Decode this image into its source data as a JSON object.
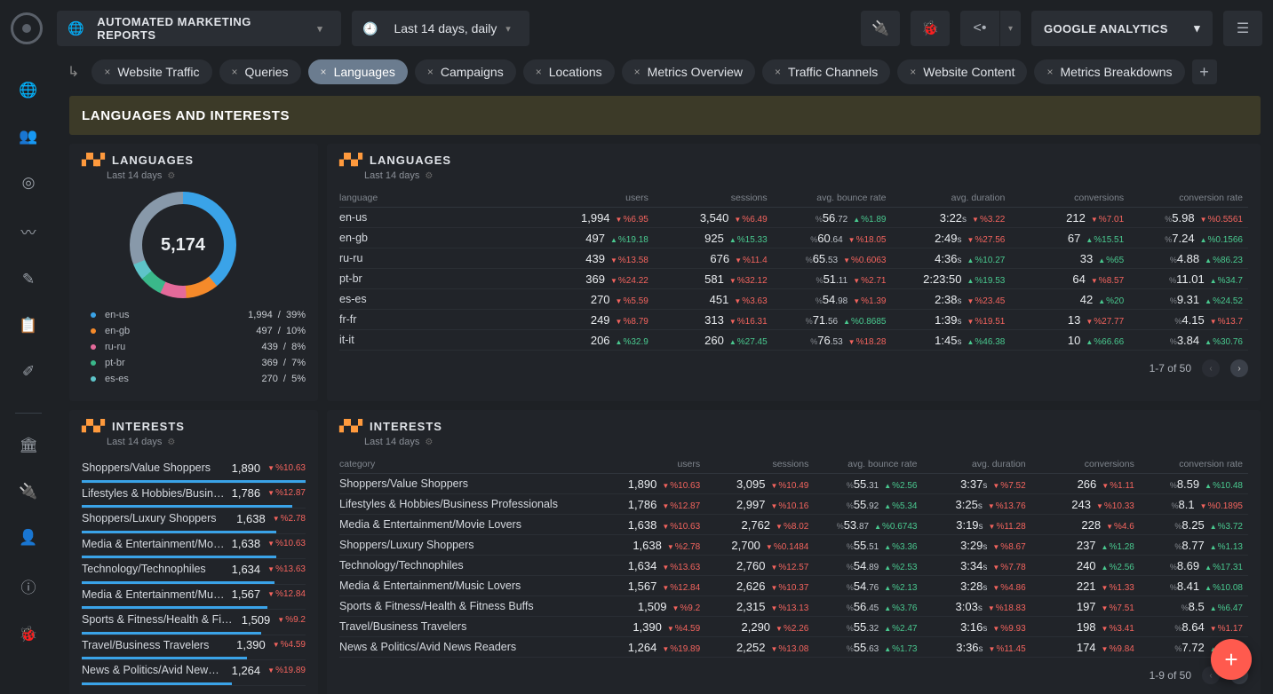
{
  "header": {
    "workspace": "AUTOMATED MARKETING REPORTS",
    "daterange": "Last 14 days, daily",
    "integration": "GOOGLE ANALYTICS"
  },
  "tabs": [
    "Website Traffic",
    "Queries",
    "Languages",
    "Campaigns",
    "Locations",
    "Metrics Overview",
    "Traffic Channels",
    "Website Content",
    "Metrics Breakdowns"
  ],
  "activeTab": 2,
  "pageTitle": "LANGUAGES AND INTERESTS",
  "langSummary": {
    "title": "LANGUAGES",
    "sub": "Last 14 days",
    "total": "5,174",
    "legend": [
      {
        "color": "#3aa3e8",
        "label": "en-us",
        "val": "1,994",
        "pct": "39%"
      },
      {
        "color": "#f58a2a",
        "label": "en-gb",
        "val": "497",
        "pct": "10%"
      },
      {
        "color": "#e46a9a",
        "label": "ru-ru",
        "val": "439",
        "pct": "8%"
      },
      {
        "color": "#3ab88a",
        "label": "pt-br",
        "val": "369",
        "pct": "7%"
      },
      {
        "color": "#5ec4c9",
        "label": "es-es",
        "val": "270",
        "pct": "5%"
      }
    ]
  },
  "langTable": {
    "title": "LANGUAGES",
    "sub": "Last 14 days",
    "cols": [
      "language",
      "users",
      "sessions",
      "avg. bounce rate",
      "avg. duration",
      "conversions",
      "conversion rate"
    ],
    "pager": "1-7 of 50",
    "rows": [
      {
        "k": "en-us",
        "u": {
          "v": "1,994",
          "d": "%6.95",
          "dir": "down"
        },
        "s": {
          "v": "3,540",
          "d": "%6.49",
          "dir": "down"
        },
        "b": {
          "v": "56",
          "sm": ".72",
          "d": "%1.89",
          "dir": "up"
        },
        "dur": {
          "v": "3:22",
          "sm": "s",
          "d": "%3.22",
          "dir": "down"
        },
        "c": {
          "v": "212",
          "d": "%7.01",
          "dir": "down"
        },
        "cr": {
          "v": "5.98",
          "d": "%0.5561",
          "dir": "down"
        }
      },
      {
        "k": "en-gb",
        "u": {
          "v": "497",
          "d": "%19.18",
          "dir": "up"
        },
        "s": {
          "v": "925",
          "d": "%15.33",
          "dir": "up"
        },
        "b": {
          "v": "60",
          "sm": ".64",
          "d": "%18.05",
          "dir": "down"
        },
        "dur": {
          "v": "2:49",
          "sm": "s",
          "d": "%27.56",
          "dir": "down"
        },
        "c": {
          "v": "67",
          "d": "%15.51",
          "dir": "up"
        },
        "cr": {
          "v": "7.24",
          "d": "%0.1566",
          "dir": "up"
        }
      },
      {
        "k": "ru-ru",
        "u": {
          "v": "439",
          "d": "%13.58",
          "dir": "down"
        },
        "s": {
          "v": "676",
          "d": "%11.4",
          "dir": "down"
        },
        "b": {
          "v": "65",
          "sm": ".53",
          "d": "%0.6063",
          "dir": "down"
        },
        "dur": {
          "v": "4:36",
          "sm": "s",
          "d": "%10.27",
          "dir": "up"
        },
        "c": {
          "v": "33",
          "d": "%65",
          "dir": "up"
        },
        "cr": {
          "v": "4.88",
          "d": "%86.23",
          "dir": "up"
        }
      },
      {
        "k": "pt-br",
        "u": {
          "v": "369",
          "d": "%24.22",
          "dir": "down"
        },
        "s": {
          "v": "581",
          "d": "%32.12",
          "dir": "down"
        },
        "b": {
          "v": "51",
          "sm": ".11",
          "d": "%2.71",
          "dir": "down"
        },
        "dur": {
          "v": "2:23:50",
          "sm": "",
          "d": "%19.53",
          "dir": "up"
        },
        "c": {
          "v": "64",
          "d": "%8.57",
          "dir": "down"
        },
        "cr": {
          "v": "11.01",
          "d": "%34.7",
          "dir": "up"
        }
      },
      {
        "k": "es-es",
        "u": {
          "v": "270",
          "d": "%5.59",
          "dir": "down"
        },
        "s": {
          "v": "451",
          "d": "%3.63",
          "dir": "down"
        },
        "b": {
          "v": "54",
          "sm": ".98",
          "d": "%1.39",
          "dir": "down"
        },
        "dur": {
          "v": "2:38",
          "sm": "s",
          "d": "%23.45",
          "dir": "down"
        },
        "c": {
          "v": "42",
          "d": "%20",
          "dir": "up"
        },
        "cr": {
          "v": "9.31",
          "d": "%24.52",
          "dir": "up"
        }
      },
      {
        "k": "fr-fr",
        "u": {
          "v": "249",
          "d": "%8.79",
          "dir": "down"
        },
        "s": {
          "v": "313",
          "d": "%16.31",
          "dir": "down"
        },
        "b": {
          "v": "71",
          "sm": ".56",
          "d": "%0.8685",
          "dir": "up"
        },
        "dur": {
          "v": "1:39",
          "sm": "s",
          "d": "%19.51",
          "dir": "down"
        },
        "c": {
          "v": "13",
          "d": "%27.77",
          "dir": "down"
        },
        "cr": {
          "v": "4.15",
          "d": "%13.7",
          "dir": "down"
        }
      },
      {
        "k": "it-it",
        "u": {
          "v": "206",
          "d": "%32.9",
          "dir": "up"
        },
        "s": {
          "v": "260",
          "d": "%27.45",
          "dir": "up"
        },
        "b": {
          "v": "76",
          "sm": ".53",
          "d": "%18.28",
          "dir": "down"
        },
        "dur": {
          "v": "1:45",
          "sm": "s",
          "d": "%46.38",
          "dir": "up"
        },
        "c": {
          "v": "10",
          "d": "%66.66",
          "dir": "up"
        },
        "cr": {
          "v": "3.84",
          "d": "%30.76",
          "dir": "up"
        }
      }
    ]
  },
  "intBars": {
    "title": "INTERESTS",
    "sub": "Last 14 days",
    "max": 1890,
    "rows": [
      {
        "label": "Shoppers/Value Shoppers",
        "v": "1,890",
        "n": 1890,
        "d": "%10.63",
        "dir": "down"
      },
      {
        "label": "Lifestyles & Hobbies/Busin…",
        "v": "1,786",
        "n": 1786,
        "d": "%12.87",
        "dir": "down"
      },
      {
        "label": "Shoppers/Luxury Shoppers",
        "v": "1,638",
        "n": 1638,
        "d": "%2.78",
        "dir": "down"
      },
      {
        "label": "Media & Entertainment/Mo…",
        "v": "1,638",
        "n": 1638,
        "d": "%10.63",
        "dir": "down"
      },
      {
        "label": "Technology/Technophiles",
        "v": "1,634",
        "n": 1634,
        "d": "%13.63",
        "dir": "down"
      },
      {
        "label": "Media & Entertainment/Mu…",
        "v": "1,567",
        "n": 1567,
        "d": "%12.84",
        "dir": "down"
      },
      {
        "label": "Sports & Fitness/Health & Fit…",
        "v": "1,509",
        "n": 1509,
        "d": "%9.2",
        "dir": "down"
      },
      {
        "label": "Travel/Business Travelers",
        "v": "1,390",
        "n": 1390,
        "d": "%4.59",
        "dir": "down"
      },
      {
        "label": "News & Politics/Avid News…",
        "v": "1,264",
        "n": 1264,
        "d": "%19.89",
        "dir": "down"
      }
    ]
  },
  "intTable": {
    "title": "INTERESTS",
    "sub": "Last 14 days",
    "cols": [
      "category",
      "users",
      "sessions",
      "avg. bounce rate",
      "avg. duration",
      "conversions",
      "conversion rate"
    ],
    "pager": "1-9 of 50",
    "rows": [
      {
        "k": "Shoppers/Value Shoppers",
        "u": {
          "v": "1,890",
          "d": "%10.63",
          "dir": "down"
        },
        "s": {
          "v": "3,095",
          "d": "%10.49",
          "dir": "down"
        },
        "b": {
          "v": "55",
          "sm": ".31",
          "d": "%2.56",
          "dir": "up"
        },
        "dur": {
          "v": "3:37",
          "sm": "s",
          "d": "%7.52",
          "dir": "down"
        },
        "c": {
          "v": "266",
          "d": "%1.11",
          "dir": "down"
        },
        "cr": {
          "v": "8.59",
          "d": "%10.48",
          "dir": "up"
        }
      },
      {
        "k": "Lifestyles & Hobbies/Business Professionals",
        "u": {
          "v": "1,786",
          "d": "%12.87",
          "dir": "down"
        },
        "s": {
          "v": "2,997",
          "d": "%10.16",
          "dir": "down"
        },
        "b": {
          "v": "55",
          "sm": ".92",
          "d": "%5.34",
          "dir": "up"
        },
        "dur": {
          "v": "3:25",
          "sm": "s",
          "d": "%13.76",
          "dir": "down"
        },
        "c": {
          "v": "243",
          "d": "%10.33",
          "dir": "down"
        },
        "cr": {
          "v": "8.1",
          "d": "%0.1895",
          "dir": "down"
        }
      },
      {
        "k": "Media & Entertainment/Movie Lovers",
        "u": {
          "v": "1,638",
          "d": "%10.63",
          "dir": "down"
        },
        "s": {
          "v": "2,762",
          "d": "%8.02",
          "dir": "down"
        },
        "b": {
          "v": "53",
          "sm": ".87",
          "d": "%0.6743",
          "dir": "up"
        },
        "dur": {
          "v": "3:19",
          "sm": "s",
          "d": "%11.28",
          "dir": "down"
        },
        "c": {
          "v": "228",
          "d": "%4.6",
          "dir": "down"
        },
        "cr": {
          "v": "8.25",
          "d": "%3.72",
          "dir": "up"
        }
      },
      {
        "k": "Shoppers/Luxury Shoppers",
        "u": {
          "v": "1,638",
          "d": "%2.78",
          "dir": "down"
        },
        "s": {
          "v": "2,700",
          "d": "%0.1484",
          "dir": "down"
        },
        "b": {
          "v": "55",
          "sm": ".51",
          "d": "%3.36",
          "dir": "up"
        },
        "dur": {
          "v": "3:29",
          "sm": "s",
          "d": "%8.67",
          "dir": "down"
        },
        "c": {
          "v": "237",
          "d": "%1.28",
          "dir": "up"
        },
        "cr": {
          "v": "8.77",
          "d": "%1.13",
          "dir": "up"
        }
      },
      {
        "k": "Technology/Technophiles",
        "u": {
          "v": "1,634",
          "d": "%13.63",
          "dir": "down"
        },
        "s": {
          "v": "2,760",
          "d": "%12.57",
          "dir": "down"
        },
        "b": {
          "v": "54",
          "sm": ".89",
          "d": "%2.53",
          "dir": "up"
        },
        "dur": {
          "v": "3:34",
          "sm": "s",
          "d": "%7.78",
          "dir": "down"
        },
        "c": {
          "v": "240",
          "d": "%2.56",
          "dir": "up"
        },
        "cr": {
          "v": "8.69",
          "d": "%17.31",
          "dir": "up"
        }
      },
      {
        "k": "Media & Entertainment/Music Lovers",
        "u": {
          "v": "1,567",
          "d": "%12.84",
          "dir": "down"
        },
        "s": {
          "v": "2,626",
          "d": "%10.37",
          "dir": "down"
        },
        "b": {
          "v": "54",
          "sm": ".76",
          "d": "%2.13",
          "dir": "up"
        },
        "dur": {
          "v": "3:28",
          "sm": "s",
          "d": "%4.86",
          "dir": "down"
        },
        "c": {
          "v": "221",
          "d": "%1.33",
          "dir": "down"
        },
        "cr": {
          "v": "8.41",
          "d": "%10.08",
          "dir": "up"
        }
      },
      {
        "k": "Sports & Fitness/Health & Fitness Buffs",
        "u": {
          "v": "1,509",
          "d": "%9.2",
          "dir": "down"
        },
        "s": {
          "v": "2,315",
          "d": "%13.13",
          "dir": "down"
        },
        "b": {
          "v": "56",
          "sm": ".45",
          "d": "%3.76",
          "dir": "up"
        },
        "dur": {
          "v": "3:03",
          "sm": "s",
          "d": "%18.83",
          "dir": "down"
        },
        "c": {
          "v": "197",
          "d": "%7.51",
          "dir": "down"
        },
        "cr": {
          "v": "8.5",
          "d": "%6.47",
          "dir": "up"
        }
      },
      {
        "k": "Travel/Business Travelers",
        "u": {
          "v": "1,390",
          "d": "%4.59",
          "dir": "down"
        },
        "s": {
          "v": "2,290",
          "d": "%2.26",
          "dir": "down"
        },
        "b": {
          "v": "55",
          "sm": ".32",
          "d": "%2.47",
          "dir": "up"
        },
        "dur": {
          "v": "3:16",
          "sm": "s",
          "d": "%9.93",
          "dir": "down"
        },
        "c": {
          "v": "198",
          "d": "%3.41",
          "dir": "down"
        },
        "cr": {
          "v": "8.64",
          "d": "%1.17",
          "dir": "down"
        }
      },
      {
        "k": "News & Politics/Avid News Readers",
        "u": {
          "v": "1,264",
          "d": "%19.89",
          "dir": "down"
        },
        "s": {
          "v": "2,252",
          "d": "%13.08",
          "dir": "down"
        },
        "b": {
          "v": "55",
          "sm": ".63",
          "d": "%1.73",
          "dir": "up"
        },
        "dur": {
          "v": "3:36",
          "sm": "s",
          "d": "%11.45",
          "dir": "down"
        },
        "c": {
          "v": "174",
          "d": "%9.84",
          "dir": "down"
        },
        "cr": {
          "v": "7.72",
          "d": "%3.72",
          "dir": "up"
        }
      }
    ]
  }
}
